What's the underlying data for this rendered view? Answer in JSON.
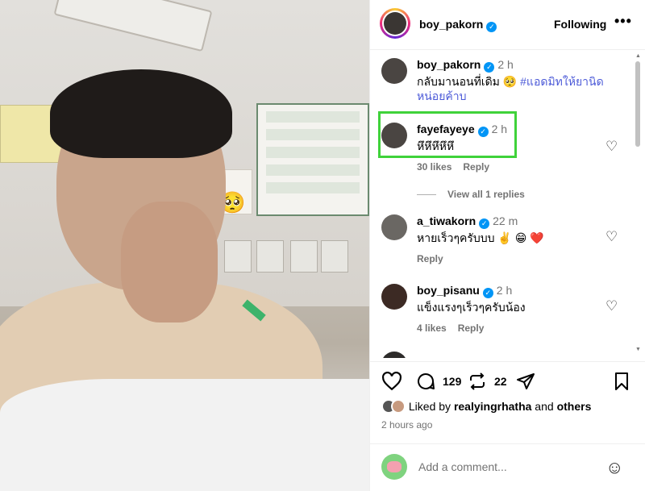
{
  "header": {
    "username": "boy_pakorn",
    "follow_label": "Following",
    "more_label": "•••"
  },
  "comments": [
    {
      "user": "boy_pakorn",
      "time": "2 h",
      "text": "กลับมานอนที่เดิม 🥺 ",
      "tag": "#แอดมิทให้ยานิดหน่อยค้าบ",
      "likes": "",
      "reply": ""
    },
    {
      "user": "fayefayeye",
      "time": "2 h",
      "text": "หึหึหึหึหึ",
      "likes": "30 likes",
      "reply": "Reply"
    },
    {
      "user": "a_tiwakorn",
      "time": "22 m",
      "text": "หายเร็วๆครับบบ ✌️ 😁 ❤️",
      "likes": "",
      "reply": "Reply"
    },
    {
      "user": "boy_pisanu",
      "time": "2 h",
      "text": "แข็งแรงๆเร็วๆครับน้อง",
      "likes": "4 likes",
      "reply": "Reply"
    }
  ],
  "view_replies": "View all 1 replies",
  "actions": {
    "comments_count": "129",
    "reposts_count": "22"
  },
  "liked_by": {
    "prefix": "Liked by ",
    "user": "realyingrhatha",
    "and": " and ",
    "others": "others"
  },
  "posted_ago": "2 hours ago",
  "add_comment": {
    "placeholder": "Add a comment..."
  },
  "colors": {
    "verified": "#0095f6",
    "hashtag": "#4d5bd8",
    "highlight": "#3fd23a"
  }
}
